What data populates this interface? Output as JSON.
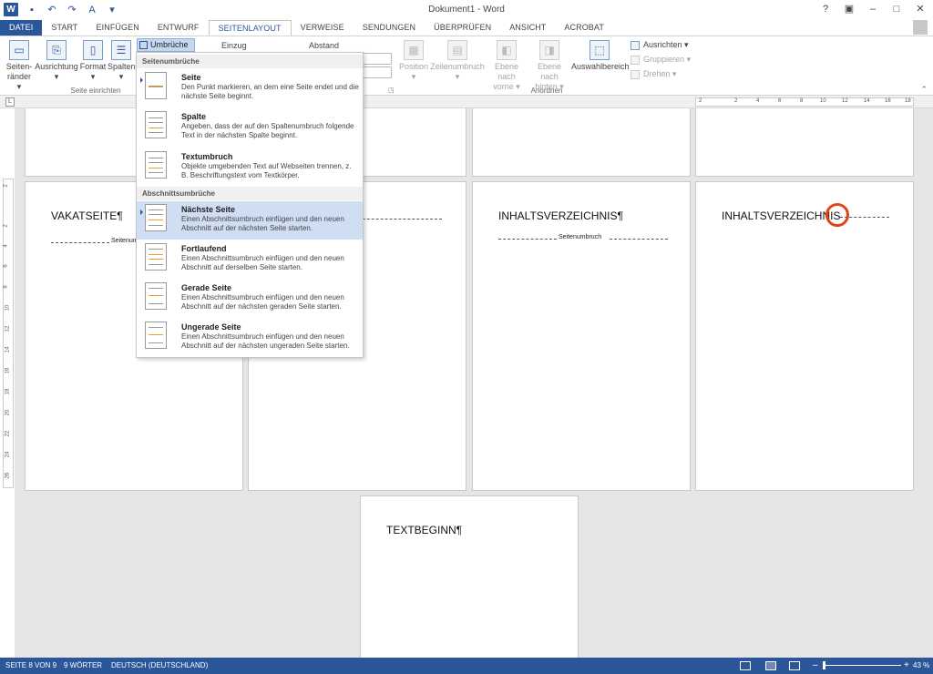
{
  "window": {
    "title": "Dokument1 - Word",
    "controls": [
      "?",
      "▣",
      "–",
      "□",
      "✕"
    ]
  },
  "tabs": [
    "DATEI",
    "START",
    "EINFÜGEN",
    "ENTWURF",
    "SEITENLAYOUT",
    "VERWEISE",
    "SENDUNGEN",
    "ÜBERPRÜFEN",
    "ANSICHT",
    "ACROBAT"
  ],
  "active_tab": "SEITENLAYOUT",
  "ribbon": {
    "seitenraender": "Seiten-",
    "seitenraender2": "ränder",
    "ausrichtung": "Ausrichtung",
    "format": "Format",
    "spalten": "Spalten",
    "umbrueche": "Umbrüche",
    "einzug": "Einzug",
    "abstand": "Abstand",
    "group_seite": "Seite einrichten",
    "position": "Position",
    "zeilenumbruch": "Zeilenumbruch",
    "ebene_vorne": "Ebene nach",
    "ebene_vorne2": "vorne",
    "ebene_hinten": "Ebene nach",
    "ebene_hinten2": "hinten",
    "auswahlbereich": "Auswahlbereich",
    "ausrichten": "Ausrichten",
    "gruppieren": "Gruppieren",
    "drehen": "Drehen",
    "group_anordnen": "Anordnen"
  },
  "ruler": {
    "h_ticks": [
      "2",
      "2",
      "4",
      "6",
      "8",
      "10",
      "12",
      "14",
      "16",
      "18"
    ],
    "v_ticks": [
      "2",
      "2",
      "4",
      "6",
      "8",
      "10",
      "12",
      "14",
      "16",
      "18",
      "20",
      "22",
      "24",
      "26"
    ]
  },
  "menu": {
    "section1": "Seitenumbrüche",
    "section2": "Abschnittsumbrüche",
    "items": [
      {
        "title": "Seite",
        "desc": "Den Punkt markieren, an dem eine Seite endet und die nächste Seite beginnt."
      },
      {
        "title": "Spalte",
        "desc": "Angeben, dass der auf den Spaltenumbruch folgende Text in der nächsten Spalte beginnt."
      },
      {
        "title": "Textumbruch",
        "desc": "Objekte umgebenden Text auf Webseiten trennen, z. B. Beschriftungstext vom Textkörper."
      },
      {
        "title": "Nächste Seite",
        "desc": "Einen Abschnittsumbruch einfügen und den neuen Abschnitt auf der nächsten Seite starten."
      },
      {
        "title": "Fortlaufend",
        "desc": "Einen Abschnittsumbruch einfügen und den neuen Abschnitt auf derselben Seite starten."
      },
      {
        "title": "Gerade Seite",
        "desc": "Einen Abschnittsumbruch einfügen und den neuen Abschnitt auf der nächsten geraden Seite starten."
      },
      {
        "title": "Ungerade Seite",
        "desc": "Einen Abschnittsumbruch einfügen und den neuen Abschnitt auf der nächsten ungeraden Seite starten."
      }
    ]
  },
  "pages": {
    "vakatseite": "VAKATSEITE¶",
    "seitenumbruch_cut": "Seitenumb",
    "inhalt1": "INHALTSVERZEICHNIS¶",
    "seitenumbruch": "Seitenumbruch",
    "inhalt2": "INHALTSVERZEICHNIS",
    "textbeginn": "TEXTBEGINN¶"
  },
  "status": {
    "page": "SEITE 8 VON 9",
    "words": "9 WÖRTER",
    "lang": "DEUTSCH (DEUTSCHLAND)",
    "zoom_minus": "–",
    "zoom_plus": "+",
    "zoom": "43 %"
  },
  "colors": {
    "accent": "#2b579a",
    "highlight": "#cfdef3",
    "ring": "#e0441c"
  }
}
